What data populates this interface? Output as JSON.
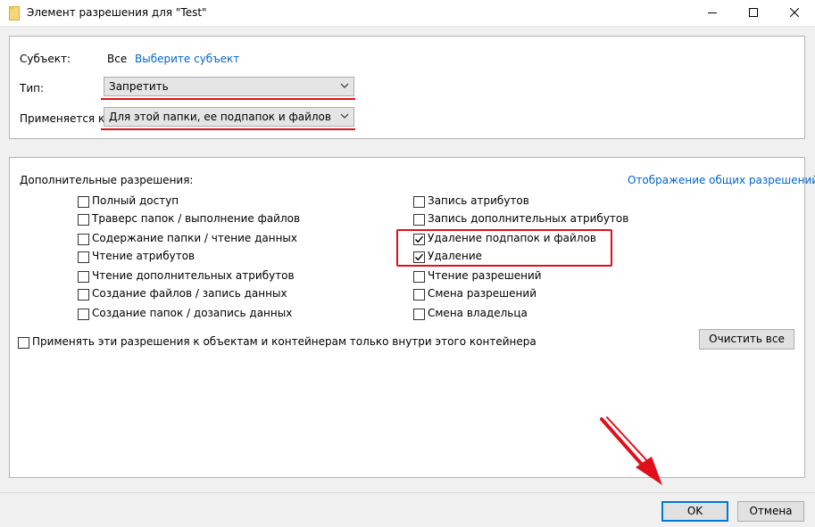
{
  "window": {
    "title": "Элемент разрешения для \"Test\"",
    "icon": "folder-icon"
  },
  "principal": {
    "label": "Субъект:",
    "value": "Все",
    "link": "Выберите субъект"
  },
  "type": {
    "label": "Тип:",
    "value": "Запретить"
  },
  "applies_to": {
    "label": "Применяется к:",
    "value": "Для этой папки, ее подпапок и файлов"
  },
  "advanced": {
    "heading": "Дополнительные разрешения:",
    "show_basic_link": "Отображение общих разрешений",
    "left_items": [
      {
        "label": "Полный доступ",
        "checked": false
      },
      {
        "label": "Траверс папок / выполнение файлов",
        "checked": false
      },
      {
        "label": "Содержание папки / чтение данных",
        "checked": false
      },
      {
        "label": "Чтение атрибутов",
        "checked": false
      },
      {
        "label": "Чтение дополнительных атрибутов",
        "checked": false
      },
      {
        "label": "Создание файлов / запись данных",
        "checked": false
      },
      {
        "label": "Создание папок / дозапись данных",
        "checked": false
      }
    ],
    "right_items": [
      {
        "label": "Запись атрибутов",
        "checked": false
      },
      {
        "label": "Запись дополнительных атрибутов",
        "checked": false
      },
      {
        "label": "Удаление подпапок и файлов",
        "checked": true
      },
      {
        "label": "Удаление",
        "checked": true
      },
      {
        "label": "Чтение разрешений",
        "checked": false
      },
      {
        "label": "Смена разрешений",
        "checked": false
      },
      {
        "label": "Смена владельца",
        "checked": false
      }
    ],
    "apply_inside_label": "Применять эти разрешения к объектам и контейнерам только внутри этого контейнера",
    "clear_all_label": "Очистить все"
  },
  "footer": {
    "ok_label": "OK",
    "cancel_label": "Отмена"
  },
  "annotation_color": "#e0101a"
}
